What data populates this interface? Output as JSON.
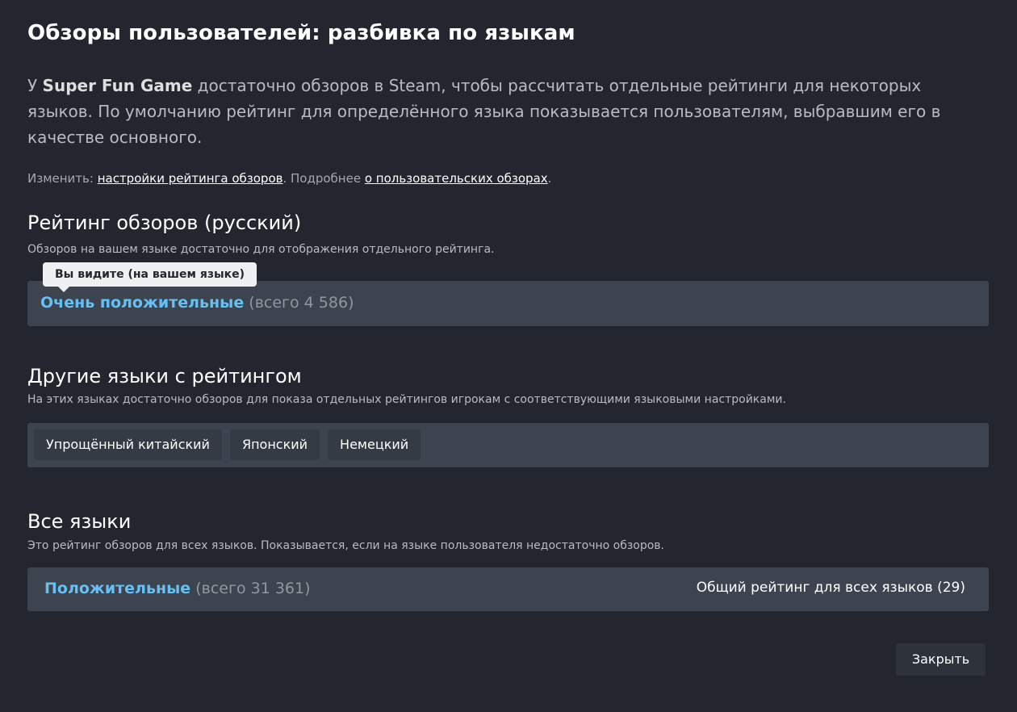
{
  "title": "Обзоры пользователей: разбивка по языкам",
  "intro": {
    "prefix": "У ",
    "game_name": "Super Fun Game",
    "rest": " достаточно обзоров в Steam, чтобы рассчитать отдельные рейтинги для некоторых языков. По умолчанию рейтинг для определённого языка показывается пользователям, выбравшим его в качестве основного."
  },
  "change_line": {
    "prefix": "Изменить: ",
    "settings_link": "настройки рейтинга обзоров",
    "middle": ". Подробнее ",
    "about_link": "о пользовательских обзорах",
    "suffix": "."
  },
  "your_language": {
    "heading": "Рейтинг обзоров (русский)",
    "subtitle": "Обзоров на вашем языке достаточно для отображения отдельного рейтинга.",
    "tooltip": "Вы видите (на вашем языке)",
    "rating_label": "Очень положительные",
    "rating_count": "(всего 4 586)"
  },
  "other_languages": {
    "heading": "Другие языки с рейтингом",
    "subtitle": "На этих языках достаточно обзоров для показа отдельных рейтингов игрокам с соответствующими языковыми настройками.",
    "chips": [
      "Упрощённый китайский",
      "Японский",
      "Немецкий"
    ]
  },
  "all_languages": {
    "heading": "Все языки",
    "subtitle": "Это рейтинг обзоров для всех языков. Показывается, если на языке пользователя недостаточно обзоров.",
    "rating_label": "Положительные",
    "rating_count": "(всего 31 361)",
    "overall_label": "Общий рейтинг для всех языков (29)"
  },
  "close_button": "Закрыть",
  "colors": {
    "background": "#23262e",
    "panel": "#3d4450",
    "accent_blue": "#66c0f4",
    "muted_text": "#8f98a0"
  }
}
